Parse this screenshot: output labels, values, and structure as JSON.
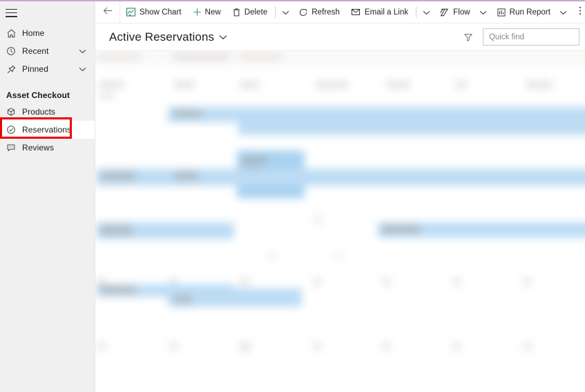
{
  "window": {
    "accent_bar_color": "#c5a8ce",
    "sidebar_bg": "#f0f0f0",
    "annotation_color": "#ee0000"
  },
  "sidebar": {
    "menu_button": "menu",
    "items": [
      {
        "label": "Home",
        "icon": "home-icon",
        "expandable": false,
        "selected": false
      },
      {
        "label": "Recent",
        "icon": "clock-icon",
        "expandable": true,
        "selected": false
      },
      {
        "label": "Pinned",
        "icon": "pin-icon",
        "expandable": true,
        "selected": false
      }
    ],
    "group": {
      "title": "Asset Checkout",
      "items": [
        {
          "label": "Products",
          "icon": "box-icon",
          "selected": false
        },
        {
          "label": "Reservations",
          "icon": "check-circle-icon",
          "selected": true
        },
        {
          "label": "Reviews",
          "icon": "comment-icon",
          "selected": false
        }
      ]
    }
  },
  "commandbar": {
    "back": "back-arrow",
    "buttons": [
      {
        "label": "Show Chart",
        "icon": "chart-icon"
      },
      {
        "label": "New",
        "icon": "plus-icon"
      },
      {
        "label": "Delete",
        "icon": "trash-icon"
      },
      {
        "label": "Refresh",
        "icon": "refresh-icon"
      },
      {
        "label": "Email a Link",
        "icon": "email-link-icon"
      },
      {
        "label": "Flow",
        "icon": "flow-icon"
      },
      {
        "label": "Run Report",
        "icon": "report-icon"
      }
    ],
    "overflow": "more-options"
  },
  "view": {
    "title": "Active Reservations",
    "selector_icon": "chevron-down-icon",
    "filter_icon": "filter-icon",
    "search": {
      "placeholder": "Quick find",
      "value": "",
      "icon": "search-icon"
    }
  },
  "grid": {
    "state": "redacted",
    "note": "Record grid content is blurred/obscured in the screenshot"
  }
}
